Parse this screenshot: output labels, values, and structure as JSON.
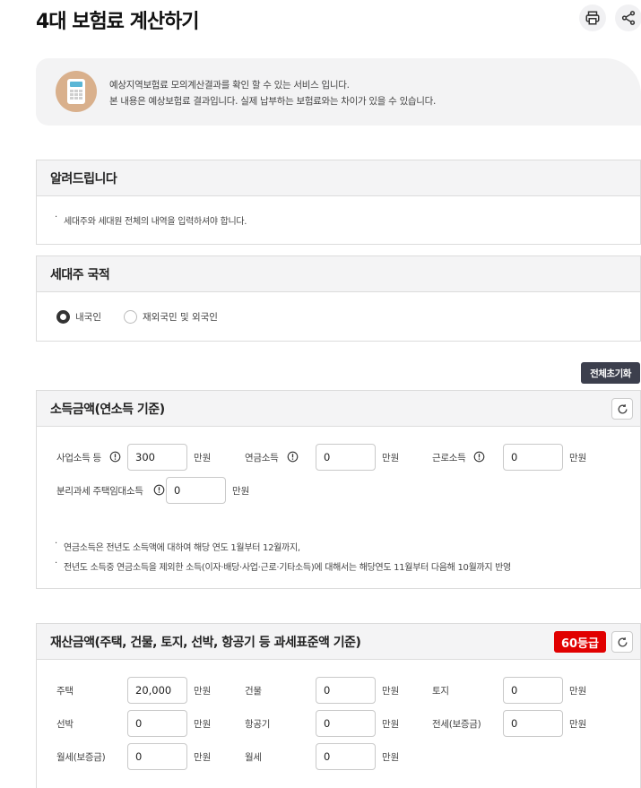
{
  "header": {
    "title": "4대 보험료 계산하기",
    "print_icon": "printer-icon",
    "share_icon": "share-icon"
  },
  "info": {
    "icon": "calculator-icon",
    "line1": "예상지역보험료 모의계산결과를 확인 할 수 있는 서비스 입니다.",
    "line2": "본 내용은 예상보험료 결과입니다. 실제 납부하는 보험료와는 차이가 있을 수 있습니다."
  },
  "notice": {
    "title": "알려드립니다",
    "items": [
      "세대주와 세대원 전체의 내역을 입력하셔야 합니다."
    ]
  },
  "nationality": {
    "title": "세대주 국적",
    "options": [
      {
        "label": "내국인",
        "selected": true
      },
      {
        "label": "재외국민 및 외국인",
        "selected": false
      }
    ]
  },
  "reset_all_label": "전체초기화",
  "income": {
    "title": "소득금액(연소득 기준)",
    "unit": "만원",
    "fields": [
      {
        "label": "사업소득 등",
        "value": "300"
      },
      {
        "label": "연금소득",
        "value": "0"
      },
      {
        "label": "근로소득",
        "value": "0"
      },
      {
        "label": "분리과세 주택임대소득",
        "value": "0"
      }
    ],
    "notes": [
      "연금소득은 전년도 소득액에 대하여 해당 연도 1월부터 12월까지,",
      "전년도 소득중 연금소득을 제외한 소득(이자·배당·사업·근로·기타소득)에 대해서는 해당연도 11월부터 다음해 10월까지 반영"
    ]
  },
  "asset": {
    "title": "재산금액(주택, 건물, 토지, 선박, 항공기 등 과세표준액 기준)",
    "grade": "60등급",
    "unit": "만원",
    "fields": [
      {
        "label": "주택",
        "value": "20,000"
      },
      {
        "label": "건물",
        "value": "0"
      },
      {
        "label": "토지",
        "value": "0"
      },
      {
        "label": "선박",
        "value": "0"
      },
      {
        "label": "항공기",
        "value": "0"
      },
      {
        "label": "전세(보증금)",
        "value": "0"
      },
      {
        "label": "월세(보증금)",
        "value": "0"
      },
      {
        "label": "월세",
        "value": "0"
      }
    ]
  }
}
